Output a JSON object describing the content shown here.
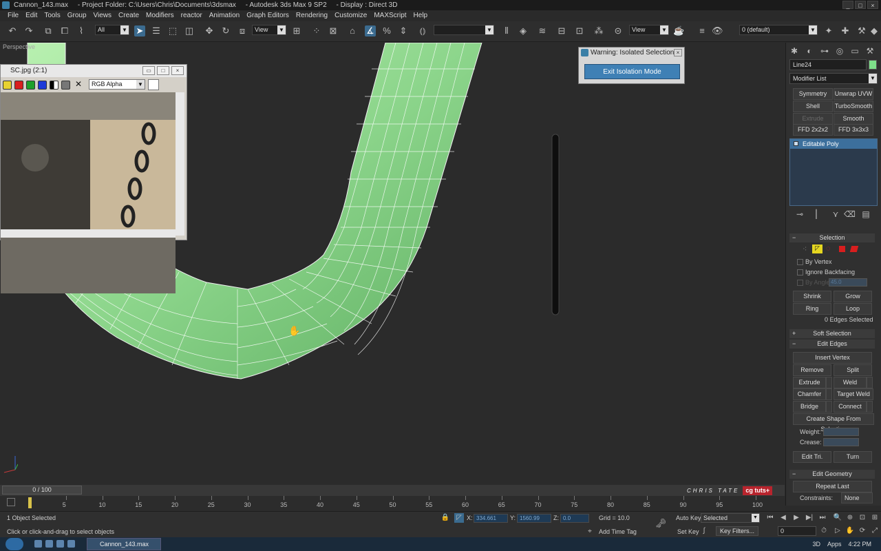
{
  "window": {
    "title": "Cannon_143.max     - Project Folder: C:\\Users\\Chris\\Documents\\3dsmax     - Autodesk 3ds Max 9 SP2     - Display : Direct 3D",
    "buttons": [
      "_",
      "□",
      "×"
    ]
  },
  "menu": [
    "File",
    "Edit",
    "Tools",
    "Group",
    "Views",
    "Create",
    "Modifiers",
    "reactor",
    "Animation",
    "Graph Editors",
    "Rendering",
    "Customize",
    "MAXScript",
    "Help"
  ],
  "toolbar": {
    "selection_filter": "All",
    "ref_coord_1": "View",
    "ref_coord_2": "View",
    "named_selection": "",
    "layer": "0 (default)"
  },
  "viewport": {
    "label": "Perspective"
  },
  "image_window": {
    "title": "SC.jpg (2:1)",
    "channel": "RGB Alpha",
    "buttons": [
      "▭",
      "□",
      "×"
    ]
  },
  "warning": {
    "title": "Warning: Isolated Selection",
    "close": "×",
    "button": "Exit Isolation Mode"
  },
  "command_panel": {
    "object_name": "Line24",
    "object_color": "#7ee08a",
    "modifier_list": "Modifier List",
    "modifier_buttons": [
      [
        "Symmetry",
        "Unwrap UVW"
      ],
      [
        "Shell",
        "TurboSmooth"
      ],
      [
        "Extrude",
        "Smooth"
      ],
      [
        "FFD 2x2x2",
        "FFD 3x3x3"
      ]
    ],
    "stack_item": "Editable Poly",
    "selection": {
      "header": "Selection",
      "by_vertex": "By Vertex",
      "ignore_backfacing": "Ignore Backfacing",
      "by_angle": "By Angle:",
      "angle_value": "45.0",
      "shrink": "Shrink",
      "grow": "Grow",
      "ring": "Ring",
      "loop": "Loop",
      "status": "0 Edges Selected"
    },
    "soft_selection": "Soft Selection",
    "edit_edges": {
      "header": "Edit Edges",
      "insert_vertex": "Insert Vertex",
      "remove": "Remove",
      "split": "Split",
      "extrude": "Extrude",
      "weld": "Weld",
      "chamfer": "Chamfer",
      "target_weld": "Target Weld",
      "bridge": "Bridge",
      "connect": "Connect",
      "create_shape": "Create Shape From Selection",
      "weight": "Weight:",
      "crease": "Crease:",
      "edit_tri": "Edit Tri.",
      "turn": "Turn"
    },
    "edit_geometry": {
      "header": "Edit Geometry",
      "repeat_last": "Repeat Last",
      "constraints": "Constraints:",
      "constraints_value": "None"
    }
  },
  "timeline": {
    "frame_display": "0 / 100",
    "ticks": [
      5,
      10,
      15,
      20,
      25,
      30,
      35,
      40,
      45,
      50,
      55,
      60,
      65,
      70,
      75,
      80,
      85,
      90,
      95,
      100
    ],
    "current_frame": 0
  },
  "brand": {
    "name": "CHRIS TATE",
    "logo": "cg tuts+"
  },
  "status": {
    "selected": "1 Object Selected",
    "prompt": "Click or click-and-drag to select objects",
    "x_label": "X:",
    "x_value": "334.661",
    "y_label": "Y:",
    "y_value": "1560.99",
    "z_label": "Z:",
    "z_value": "0.0",
    "grid": "Grid = 10.0",
    "add_time_tag": "Add Time Tag",
    "auto_key": "Auto Key",
    "set_key": "Set Key",
    "key_mode": "Selected",
    "key_filters": "Key Filters...",
    "frame_field": "0"
  },
  "taskbar": {
    "app": "Cannon_143.max",
    "tray_3d": "3D",
    "tray_apps": "Apps",
    "time": "4:22 PM"
  }
}
